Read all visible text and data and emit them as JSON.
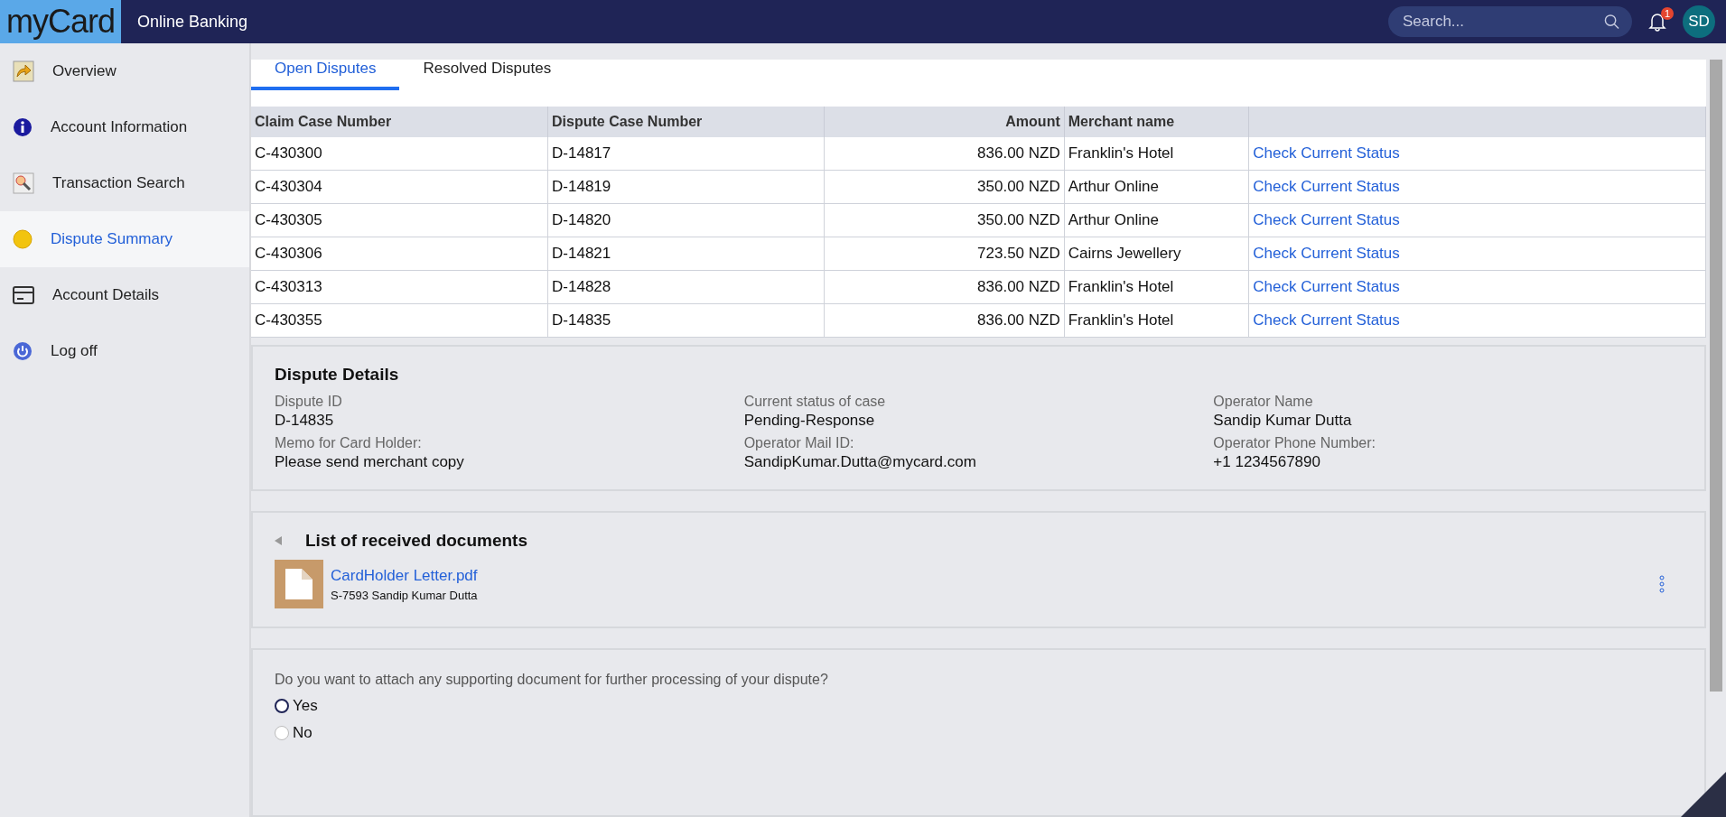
{
  "header": {
    "logo": "myCard",
    "title": "Online Banking",
    "search": {
      "placeholder": "Search..."
    },
    "notifications": "1",
    "avatar": "SD"
  },
  "sidebar": {
    "items": [
      {
        "label": "Overview",
        "kind": "arrow",
        "selected": false
      },
      {
        "label": "Account Information",
        "kind": "info",
        "selected": false
      },
      {
        "label": "Transaction Search",
        "kind": "search",
        "selected": false
      },
      {
        "label": "Dispute Summary",
        "kind": "dot",
        "selected": true
      },
      {
        "label": "Account Details",
        "kind": "card",
        "selected": false
      },
      {
        "label": "Log off",
        "kind": "power",
        "selected": false
      }
    ]
  },
  "tabs": [
    {
      "label": "Open Disputes",
      "selected": true
    },
    {
      "label": "Resolved Disputes",
      "selected": false
    }
  ],
  "table": {
    "columns": [
      "Claim Case Number",
      "Dispute Case Number",
      "Amount",
      "Merchant name"
    ],
    "rows": [
      {
        "claim": "C-430300",
        "dispute": "D-14817",
        "amount": "836.00 NZD",
        "merchant": "Franklin's Hotel",
        "link": "Check Current Status"
      },
      {
        "claim": "C-430304",
        "dispute": "D-14819",
        "amount": "350.00 NZD",
        "merchant": "Arthur Online",
        "link": "Check Current Status"
      },
      {
        "claim": "C-430305",
        "dispute": "D-14820",
        "amount": "350.00 NZD",
        "merchant": "Arthur Online",
        "link": "Check Current Status"
      },
      {
        "claim": "C-430306",
        "dispute": "D-14821",
        "amount": "723.50 NZD",
        "merchant": "Cairns Jewellery",
        "link": "Check Current Status"
      },
      {
        "claim": "C-430313",
        "dispute": "D-14828",
        "amount": "836.00 NZD",
        "merchant": "Franklin's Hotel",
        "link": "Check Current Status"
      },
      {
        "claim": "C-430355",
        "dispute": "D-14835",
        "amount": "836.00 NZD",
        "merchant": "Franklin's Hotel",
        "link": "Check Current Status"
      }
    ]
  },
  "details": {
    "title": "Dispute Details",
    "fields": [
      {
        "label": "Dispute ID",
        "value": "D-14835"
      },
      {
        "label": "Current status of case",
        "value": "Pending-Response"
      },
      {
        "label": "Operator Name",
        "value": "Sandip Kumar Dutta"
      },
      {
        "label": "Memo for Card Holder:",
        "value": "Please send merchant copy"
      },
      {
        "label": "Operator Mail ID:",
        "value": "SandipKumar.Dutta@mycard.com"
      },
      {
        "label": "Operator Phone Number:",
        "value": "+1 1234567890"
      }
    ]
  },
  "documents": {
    "title": "List of received documents",
    "items": [
      {
        "name": "CardHolder Letter.pdf",
        "meta": "S-7593 Sandip Kumar Dutta"
      }
    ]
  },
  "question": {
    "text": "Do you want to attach any supporting document for further processing of your dispute?",
    "options": [
      {
        "label": "Yes",
        "selected": false,
        "focused": true
      },
      {
        "label": "No",
        "selected": false,
        "focused": false
      }
    ]
  }
}
